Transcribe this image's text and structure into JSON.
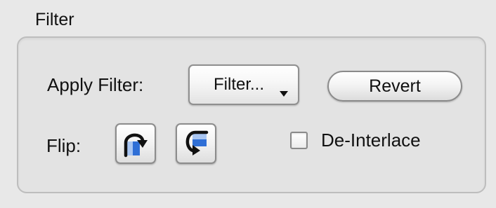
{
  "filter_group": {
    "title": "Filter",
    "apply_filter_label": "Apply Filter:",
    "filter_popup": {
      "selected": "Filter..."
    },
    "revert_button": "Revert",
    "flip_label": "Flip:",
    "flip_buttons": [
      {
        "icon": "flip-horizontal-icon"
      },
      {
        "icon": "flip-vertical-icon"
      }
    ],
    "deinterlace": {
      "label": "De-Interlace",
      "checked": false
    }
  },
  "colors": {
    "icon_blue": "#2f6fd6",
    "icon_light_blue": "#a9c6f2",
    "arrow": "#111111"
  }
}
